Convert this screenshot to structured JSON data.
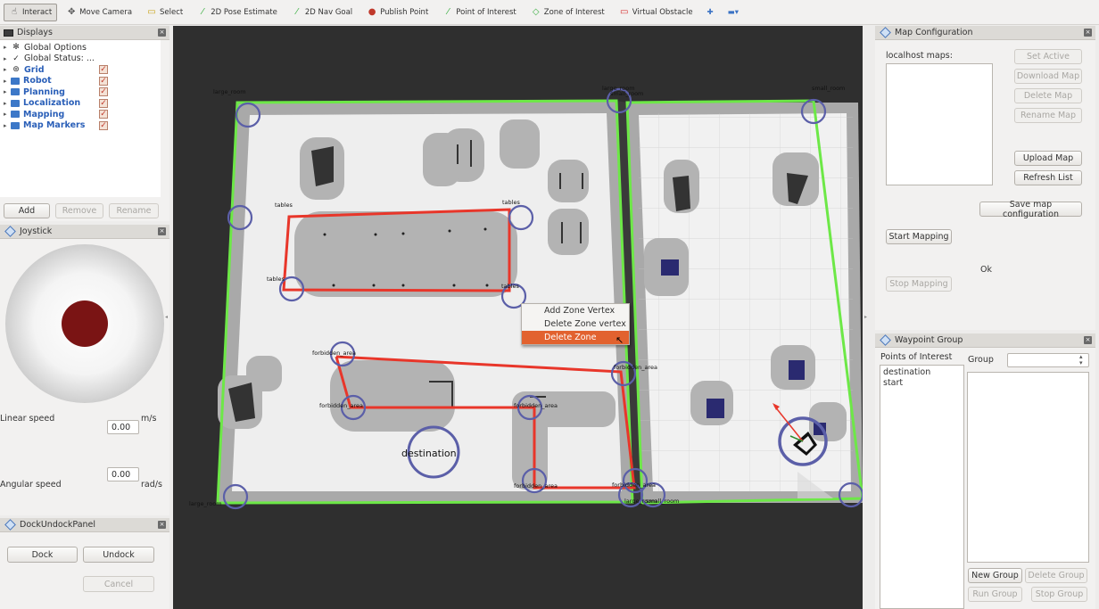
{
  "toolbar": {
    "tools": [
      {
        "label": "Interact",
        "icon": "hand-icon",
        "active": true
      },
      {
        "label": "Move Camera",
        "icon": "move-camera-icon",
        "active": false
      },
      {
        "label": "Select",
        "icon": "select-icon",
        "active": false
      },
      {
        "label": "2D Pose Estimate",
        "icon": "pose-arrow-icon",
        "active": false
      },
      {
        "label": "2D Nav Goal",
        "icon": "nav-arrow-icon",
        "active": false
      },
      {
        "label": "Publish Point",
        "icon": "map-pin-icon",
        "active": false
      },
      {
        "label": "Point of Interest",
        "icon": "poi-arrow-icon",
        "active": false
      },
      {
        "label": "Zone of Interest",
        "icon": "zone-icon",
        "active": false
      },
      {
        "label": "Virtual Obstacle",
        "icon": "obstacle-icon",
        "active": false
      }
    ]
  },
  "displays": {
    "title": "Displays",
    "items": [
      {
        "label": "Global Options",
        "icon": "gear-icon",
        "checked": null,
        "bold": false
      },
      {
        "label": "Global Status: ...",
        "icon": "check-icon",
        "checked": null,
        "bold": false
      },
      {
        "label": "Grid",
        "icon": "grid-icon",
        "checked": true,
        "bold": true
      },
      {
        "label": "Robot",
        "icon": "folder-icon",
        "checked": true,
        "bold": true
      },
      {
        "label": "Planning",
        "icon": "folder-icon",
        "checked": true,
        "bold": true
      },
      {
        "label": "Localization",
        "icon": "folder-icon",
        "checked": true,
        "bold": true
      },
      {
        "label": "Mapping",
        "icon": "folder-icon",
        "checked": true,
        "bold": true
      },
      {
        "label": "Map Markers",
        "icon": "folder-icon",
        "checked": true,
        "bold": true
      }
    ],
    "add_label": "Add",
    "remove_label": "Remove",
    "rename_label": "Rename"
  },
  "joystick": {
    "title": "Joystick",
    "linear_label": "Linear speed",
    "linear_value": "0.00",
    "linear_unit": "m/s",
    "angular_label": "Angular speed",
    "angular_value": "0.00",
    "angular_unit": "rad/s"
  },
  "dock": {
    "title": "DockUndockPanel",
    "dock_label": "Dock",
    "undock_label": "Undock",
    "cancel_label": "Cancel"
  },
  "map_config": {
    "title": "Map Configuration",
    "maps_label": "localhost maps:",
    "set_active_label": "Set Active",
    "download_label": "Download Map",
    "delete_label": "Delete Map",
    "rename_label": "Rename Map",
    "upload_label": "Upload Map",
    "refresh_label": "Refresh List",
    "save_config_label": "Save map configuration",
    "start_mapping_label": "Start Mapping",
    "status": "Ok",
    "stop_mapping_label": "Stop Mapping"
  },
  "waypoint": {
    "title": "Waypoint Group",
    "poi_label": "Points of Interest",
    "group_label": "Group",
    "group_value": "",
    "points": [
      "destination",
      "start"
    ],
    "new_group_label": "New Group",
    "delete_group_label": "Delete Group",
    "run_group_label": "Run Group",
    "stop_group_label": "Stop Group"
  },
  "context_menu": {
    "items": [
      "Add Zone Vertex",
      "Delete Zone vertex",
      "Delete Zone"
    ],
    "highlighted": 2
  },
  "map": {
    "room_labels": [
      "large_room",
      "large_room",
      "small_room",
      "small_room",
      "large_room",
      "large_room",
      "small_room"
    ],
    "table_labels": [
      "tables",
      "tables",
      "tables",
      "tables"
    ],
    "forbidden_labels": [
      "forbidden_area",
      "forbidden_area",
      "forbidden_area",
      "forbidden_area",
      "forbidden_area",
      "forbidden_area"
    ],
    "destination_label": "destination",
    "zone_color": "#6de847",
    "forbidden_color": "#e8362a",
    "marker_color": "#5b5fa8"
  }
}
